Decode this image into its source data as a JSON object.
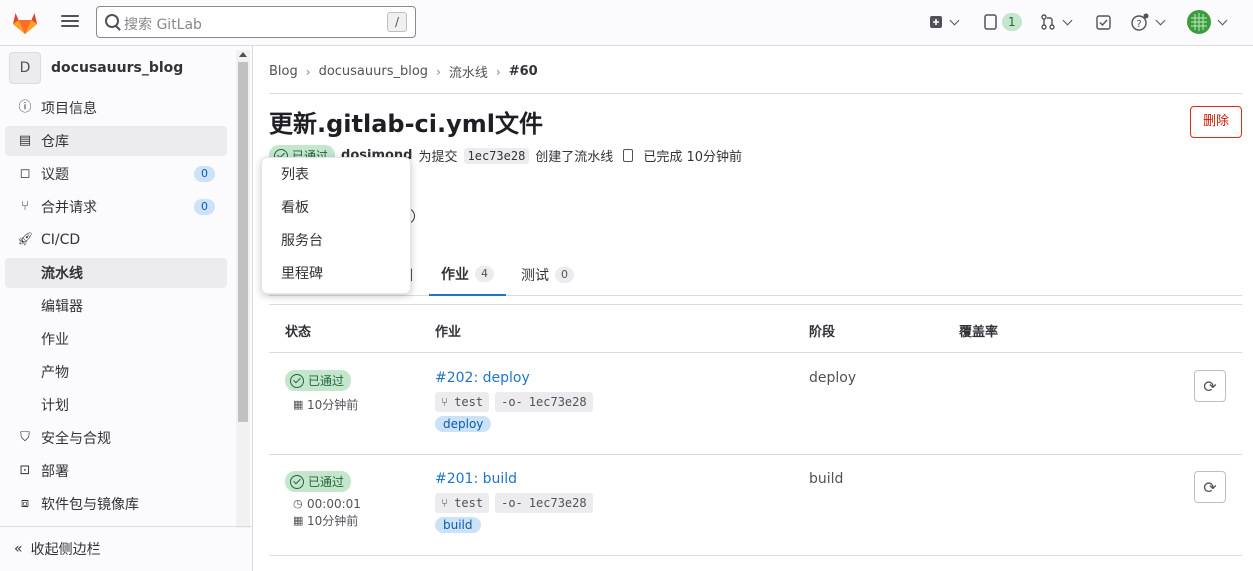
{
  "topbar": {
    "search_placeholder": "搜索 GitLab",
    "search_shortcut": "/",
    "issues_count": "1"
  },
  "sidebar": {
    "project_initial": "D",
    "project_name": "docusauurs_blog",
    "items": [
      {
        "label": "项目信息",
        "icon": "info-icon"
      },
      {
        "label": "仓库",
        "icon": "repository-icon"
      },
      {
        "label": "议题",
        "icon": "issues-icon",
        "count": "0"
      },
      {
        "label": "合并请求",
        "icon": "merge-request-icon",
        "count": "0"
      },
      {
        "label": "CI/CD",
        "icon": "rocket-icon"
      },
      {
        "label": "流水线"
      },
      {
        "label": "编辑器"
      },
      {
        "label": "作业"
      },
      {
        "label": "产物"
      },
      {
        "label": "计划"
      },
      {
        "label": "安全与合规",
        "icon": "shield-icon"
      },
      {
        "label": "部署",
        "icon": "deploy-icon"
      },
      {
        "label": "软件包与镜像库",
        "icon": "package-icon"
      }
    ],
    "collapse_label": "收起侧边栏"
  },
  "breadcrumb": [
    "Blog",
    "docusauurs_blog",
    "流水线",
    "#60"
  ],
  "page": {
    "title": "更新.gitlab-ci.yml文件",
    "delete_label": "删除",
    "status": "已通过",
    "author": "dosimond",
    "meta_for_commit": "为提交",
    "commit_sha": "1ec73e28",
    "meta_created": "创建了流水线",
    "finished": "已完成 10分钟前"
  },
  "tabs": [
    {
      "label": "图"
    },
    {
      "label": "作业",
      "count": "4"
    },
    {
      "label": "测试",
      "count": "0"
    }
  ],
  "table": {
    "headers": [
      "状态",
      "作业",
      "阶段",
      "覆盖率"
    ],
    "rows": [
      {
        "status": "已通过",
        "duration": "",
        "ago": "10分钟前",
        "job": "#202: deploy",
        "branch": "test",
        "sha": "1ec73e28",
        "tag": "deploy",
        "stage": "deploy"
      },
      {
        "status": "已通过",
        "duration": "00:00:01",
        "ago": "10分钟前",
        "job": "#201: build",
        "branch": "test",
        "sha": "1ec73e28",
        "tag": "build",
        "stage": "build"
      }
    ]
  },
  "dropdown": [
    "列表",
    "看板",
    "服务台",
    "里程碑"
  ],
  "colors": {
    "accent": "#1f75cb",
    "success": "#24663b",
    "danger": "#dd2b0e"
  }
}
